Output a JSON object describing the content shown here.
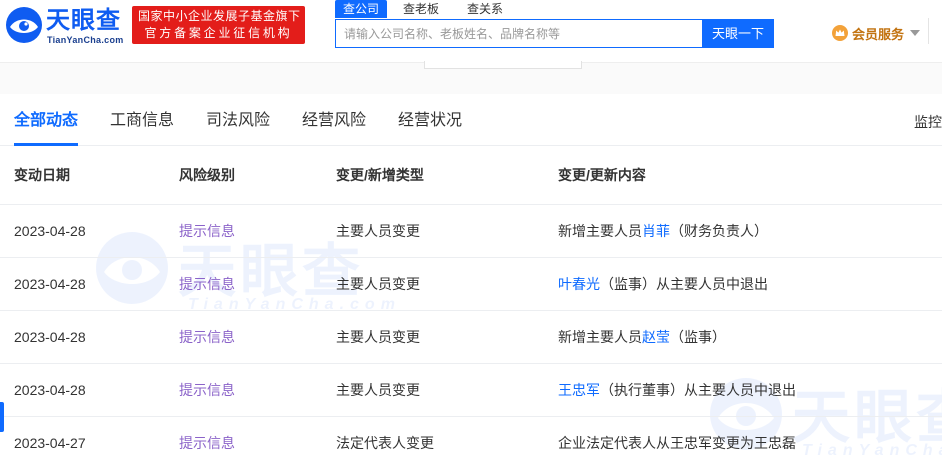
{
  "header": {
    "logo_cn": "天眼查",
    "logo_en": "TianYanCha.com",
    "badge_line1": "国家中小企业发展子基金旗下",
    "badge_line2": "官方备案企业征信机构",
    "search_tabs": [
      "查公司",
      "查老板",
      "查关系"
    ],
    "search_placeholder": "请输入公司名称、老板姓名、品牌名称等",
    "search_button": "天眼一下",
    "member_label": "会员服务"
  },
  "tabs": {
    "items": [
      "全部动态",
      "工商信息",
      "司法风险",
      "经营风险",
      "经营状况"
    ],
    "monitor_label": "监控"
  },
  "table": {
    "columns": [
      "变动日期",
      "风险级别",
      "变更/新增类型",
      "变更/更新内容"
    ],
    "rows": [
      {
        "date": "2023-04-28",
        "risk": "提示信息",
        "type": "主要人员变更",
        "pre": "新增主要人员",
        "name": "肖菲",
        "post": "（财务负责人）"
      },
      {
        "date": "2023-04-28",
        "risk": "提示信息",
        "type": "主要人员变更",
        "pre": "",
        "name": "叶春光",
        "post": "（监事）从主要人员中退出"
      },
      {
        "date": "2023-04-28",
        "risk": "提示信息",
        "type": "主要人员变更",
        "pre": "新增主要人员",
        "name": "赵莹",
        "post": "（监事）"
      },
      {
        "date": "2023-04-28",
        "risk": "提示信息",
        "type": "主要人员变更",
        "pre": "",
        "name": "王忠军",
        "post": "（执行董事）从主要人员中退出"
      },
      {
        "date": "2023-04-27",
        "risk": "提示信息",
        "type": "法定代表人变更",
        "pre": "企业法定代表人从王忠军变更为王忠磊",
        "name": "",
        "post": ""
      }
    ]
  },
  "colors": {
    "brand_blue": "#0f6bff",
    "badge_red": "#e31d1a",
    "risk_purple": "#8b63c9",
    "member_gold": "#c2720f"
  },
  "icons": {
    "logo": "eye-logo-icon",
    "member": "crown-icon",
    "dropdown": "caret-down-icon"
  }
}
